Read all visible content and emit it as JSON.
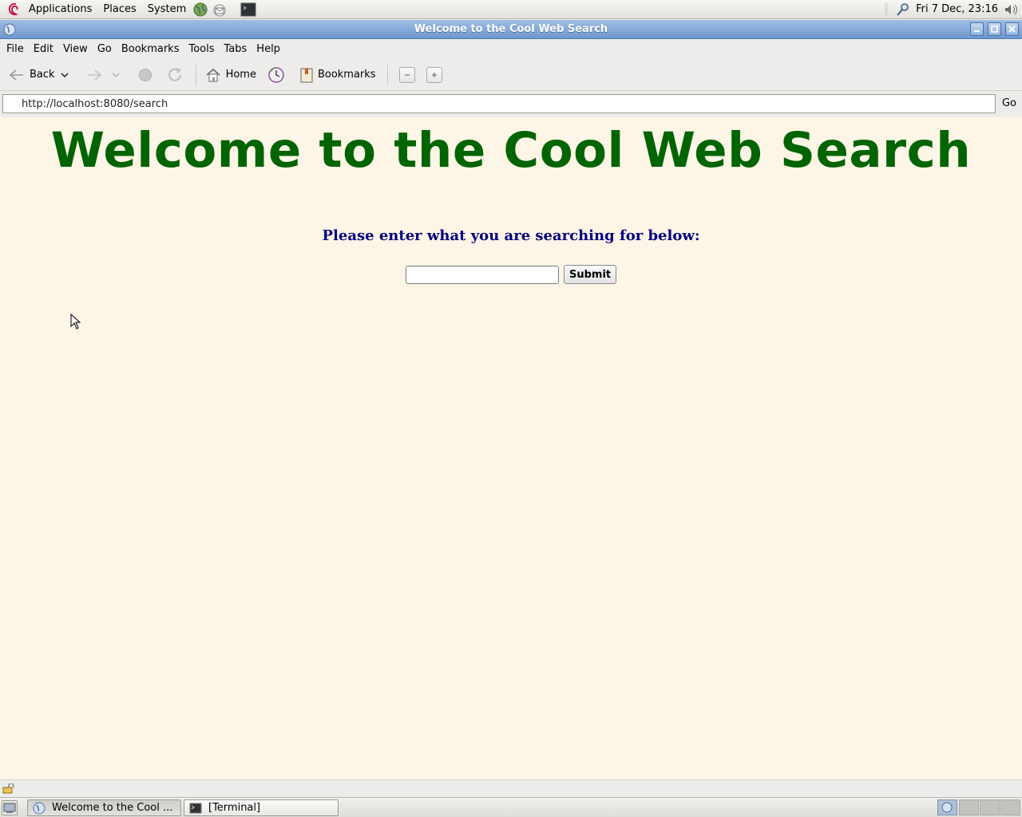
{
  "top_panel": {
    "menus": [
      "Applications",
      "Places",
      "System"
    ],
    "clock": "Fri  7 Dec, 23:16"
  },
  "window": {
    "title": "Welcome to the Cool Web Search"
  },
  "menubar": {
    "items": [
      "File",
      "Edit",
      "View",
      "Go",
      "Bookmarks",
      "Tools",
      "Tabs",
      "Help"
    ]
  },
  "toolbar": {
    "back_label": "Back",
    "home_label": "Home",
    "bookmarks_label": "Bookmarks"
  },
  "location": {
    "url": "http://localhost:8080/search",
    "go_label": "Go"
  },
  "page": {
    "heading": "Welcome to the Cool Web Search",
    "prompt": "Please enter what you are searching for below:",
    "search_value": "",
    "submit_label": "Submit",
    "background_color": "#fdf5e6",
    "heading_color": "#006400",
    "prompt_color": "#000080"
  },
  "taskbar": {
    "tasks": [
      "Welcome to the Cool ...",
      "[Terminal]"
    ]
  }
}
